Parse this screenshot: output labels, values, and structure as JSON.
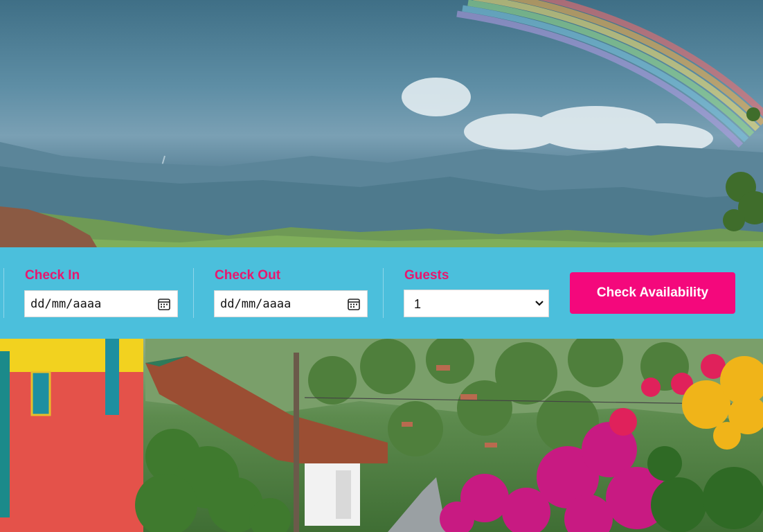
{
  "booking": {
    "check_in": {
      "label": "Check In",
      "value": "dd/mm/aaaa"
    },
    "check_out": {
      "label": "Check Out",
      "value": "dd/mm/aaaa"
    },
    "guests": {
      "label": "Guests",
      "value": "1"
    },
    "cta_label": "Check Availability"
  },
  "icons": {
    "date_picker": "calendar-icon",
    "select_arrow": "chevron-down-icon"
  },
  "colors": {
    "bar_background": "#4bbfdc",
    "label": "#e8176e",
    "cta_background": "#f4087c",
    "cta_text": "#ffffff"
  }
}
